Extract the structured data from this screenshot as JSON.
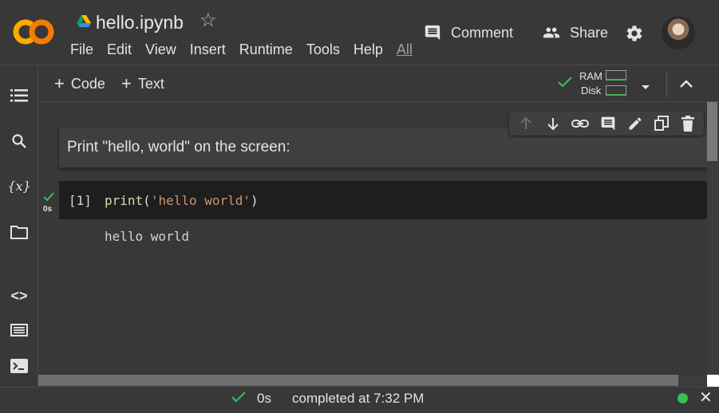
{
  "header": {
    "title": "hello.ipynb",
    "menu": [
      "File",
      "Edit",
      "View",
      "Insert",
      "Runtime",
      "Tools",
      "Help"
    ],
    "menu_all": "All",
    "comment_label": "Comment",
    "share_label": "Share"
  },
  "toolbar": {
    "add_code_label": "Code",
    "add_text_label": "Text",
    "ram_label": "RAM",
    "disk_label": "Disk"
  },
  "cells": {
    "text_cell": "Print \"hello, world\" on the screen:",
    "code_cell": {
      "exec_count": "[1]",
      "func": "print",
      "open_paren": "(",
      "string": "'hello world'",
      "close_paren": ")",
      "run_time": "0s",
      "output": "hello world"
    }
  },
  "status": {
    "time": "0s",
    "text": "completed at 7:32 PM"
  },
  "colors": {
    "accent_orange": "#f9ab00",
    "success_green": "#2fc254",
    "bg": "#383838",
    "code_bg": "#1e1e1e"
  },
  "icons": [
    "colab-logo-icon",
    "drive-icon",
    "star-icon",
    "comment-icon",
    "share-icon",
    "gear-icon",
    "toc-icon",
    "search-icon",
    "variables-icon",
    "folder-icon",
    "code-snippets-icon",
    "command-palette-icon",
    "terminal-icon",
    "check-icon",
    "chevron-down-icon",
    "chevron-up-icon",
    "arrow-up-icon",
    "arrow-down-icon",
    "link-icon",
    "comment-add-icon",
    "edit-icon",
    "mirror-cell-icon",
    "delete-icon",
    "close-icon"
  ]
}
